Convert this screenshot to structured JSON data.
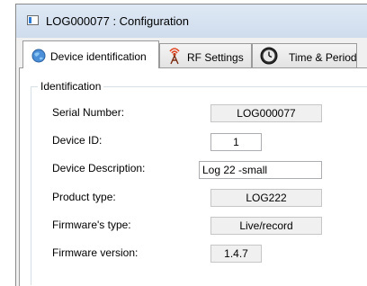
{
  "window": {
    "title": "LOG000077 : Configuration"
  },
  "tabs": [
    {
      "label": "Device identification",
      "icon": "globe-icon",
      "active": true
    },
    {
      "label": "RF Settings",
      "icon": "antenna-icon",
      "active": false
    },
    {
      "label": "Time & Period",
      "icon": "clock-icon",
      "active": false
    }
  ],
  "identification": {
    "group_title": "Identification",
    "serial_number": {
      "label": "Serial Number:",
      "value": "LOG000077"
    },
    "device_id": {
      "label": "Device ID:",
      "value": "1"
    },
    "device_description": {
      "label": "Device Description:",
      "value": "Log 22 -small"
    },
    "product_type": {
      "label": "Product type:",
      "value": "LOG222"
    },
    "firmware_type": {
      "label": "Firmware's type:",
      "value": "Live/record"
    },
    "firmware_version": {
      "label": "Firmware version:",
      "value": "1.4.7"
    }
  }
}
